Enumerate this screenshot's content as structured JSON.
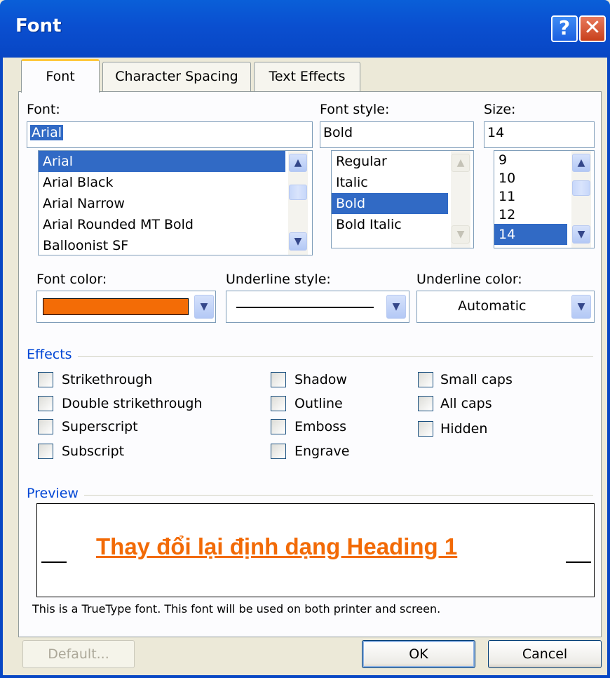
{
  "window": {
    "title": "Font",
    "help_glyph": "?",
    "close_glyph": "✕"
  },
  "tabs": [
    {
      "label": "Font",
      "active": true
    },
    {
      "label": "Character Spacing",
      "active": false
    },
    {
      "label": "Text Effects",
      "active": false
    }
  ],
  "font": {
    "label": "Font:",
    "value": "Arial",
    "items": [
      "Arial",
      "Arial Black",
      "Arial Narrow",
      "Arial Rounded MT Bold",
      "Balloonist SF"
    ],
    "selected": "Arial"
  },
  "font_style": {
    "label": "Font style:",
    "value": "Bold",
    "items": [
      "Regular",
      "Italic",
      "Bold",
      "Bold Italic"
    ],
    "selected": "Bold"
  },
  "size": {
    "label": "Size:",
    "value": "14",
    "items": [
      "9",
      "10",
      "11",
      "12",
      "14"
    ],
    "selected": "14"
  },
  "font_color": {
    "label": "Font color:",
    "color": "#f36c06"
  },
  "underline_style": {
    "label": "Underline style:"
  },
  "underline_color": {
    "label": "Underline color:",
    "value": "Automatic"
  },
  "effects": {
    "title": "Effects",
    "col1": [
      "Strikethrough",
      "Double strikethrough",
      "Superscript",
      "Subscript"
    ],
    "col2": [
      "Shadow",
      "Outline",
      "Emboss",
      "Engrave"
    ],
    "col3": [
      "Small caps",
      "All caps",
      "Hidden"
    ]
  },
  "preview": {
    "title": "Preview",
    "text": "Thay đổi lại định dạng Heading 1",
    "note": "This is a TrueType font. This font will be used on both printer and screen."
  },
  "buttons": {
    "default": "Default...",
    "ok": "OK",
    "cancel": "Cancel"
  },
  "colors": {
    "title_bar": "#0a4fd0",
    "selection": "#316ac5",
    "accent_text": "#f26a06"
  }
}
